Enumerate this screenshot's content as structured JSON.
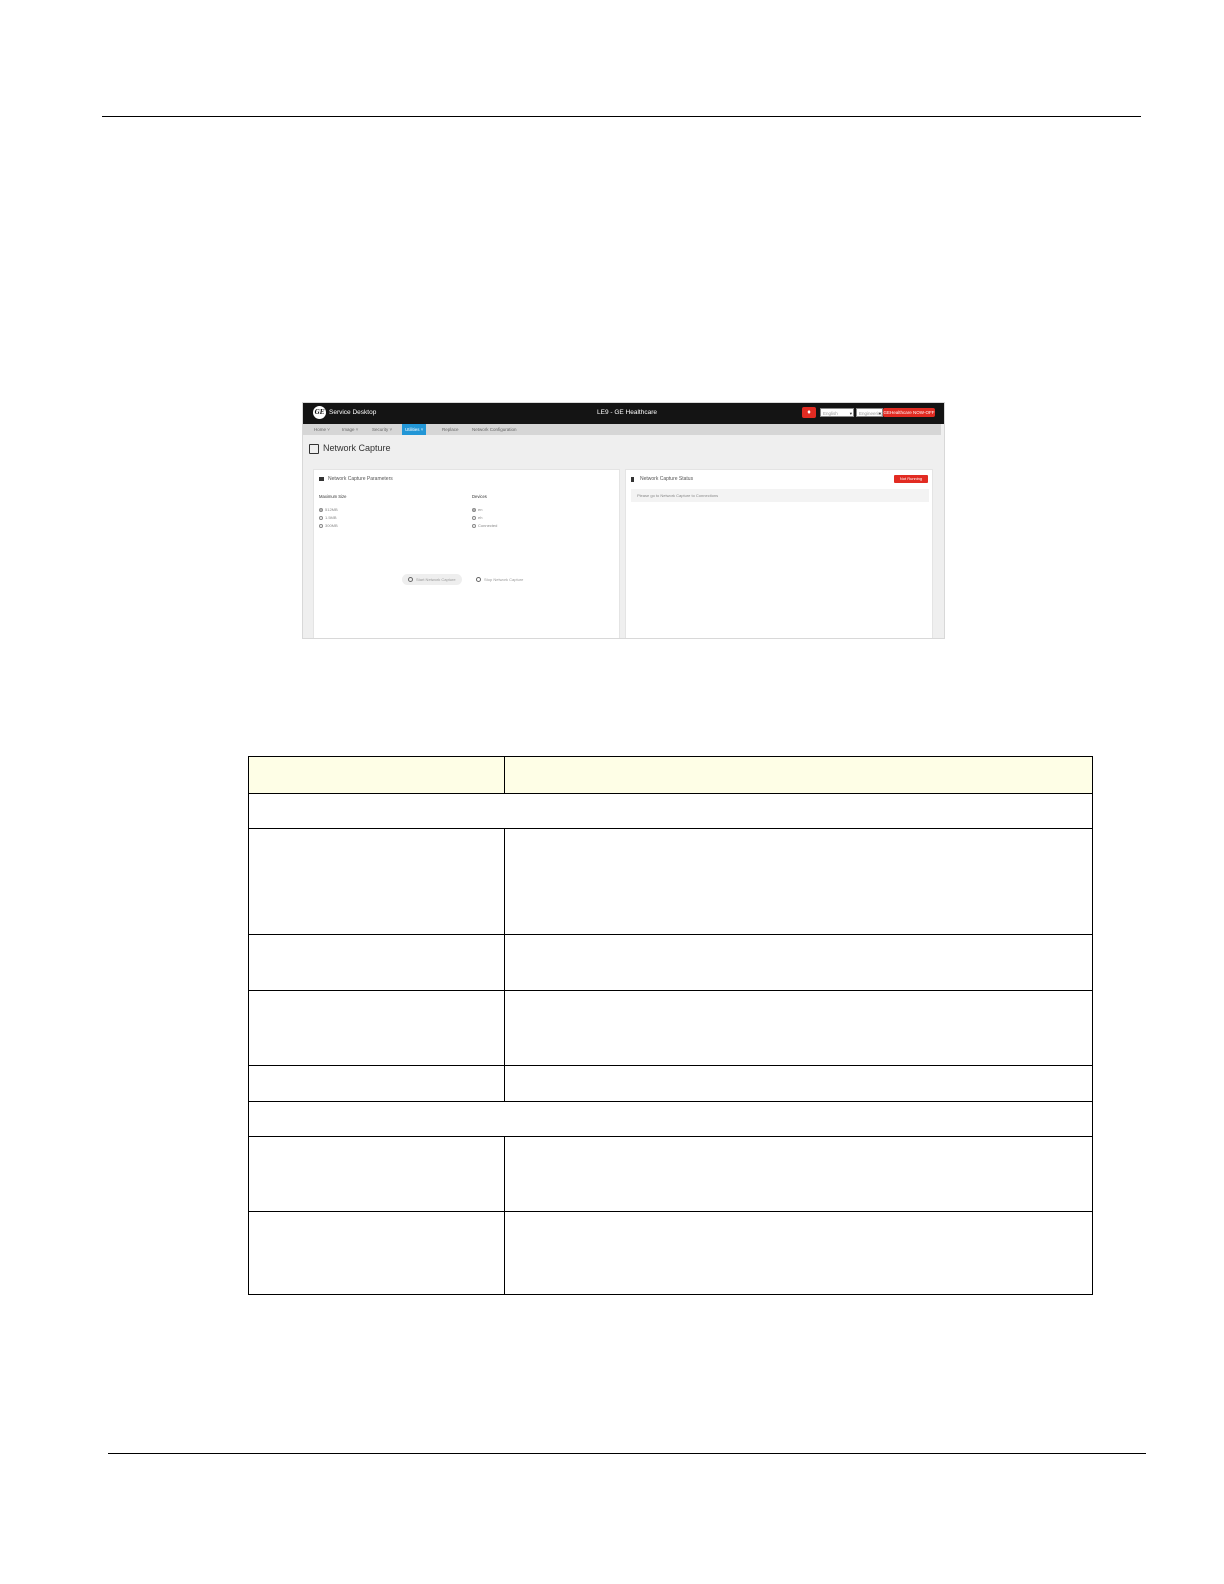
{
  "screenshot": {
    "app_name": "Service Desktop",
    "window_title": "LE9 - GE Healthcare",
    "logo_text": "GE",
    "header": {
      "bell_icon": "bell-icon",
      "language_select": "English",
      "role_select": "Engineering",
      "user_badge": "GEHealthcare NOW-OFF"
    },
    "nav_items": [
      {
        "label": "Home",
        "icon": "home-icon",
        "active": false
      },
      {
        "label": "Image",
        "icon": "image-icon",
        "active": false
      },
      {
        "label": "Security",
        "icon": "grid-icon",
        "active": false
      },
      {
        "label": "Utilities",
        "icon": "tools-icon",
        "active": true
      },
      {
        "label": "Replace",
        "icon": "heart-icon",
        "active": false
      },
      {
        "label": "Network Configuration",
        "icon": "wrench-icon",
        "active": false
      }
    ],
    "page_title": "Network Capture",
    "left_panel": {
      "title": "Network Capture Parameters",
      "max_size_label": "Maximum Size",
      "max_size_options": [
        {
          "label": "512MB",
          "selected": true
        },
        {
          "label": "1.5MB",
          "selected": false
        },
        {
          "label": "300MB",
          "selected": false
        }
      ],
      "devices_label": "Devices",
      "device_options": [
        {
          "label": "en",
          "selected": true
        },
        {
          "label": "eh",
          "selected": false
        },
        {
          "label": "Connected",
          "selected": false
        }
      ],
      "start_button": "Start Network Capture",
      "stop_button": "Stop Network Capture"
    },
    "right_panel": {
      "title": "Network Capture Status",
      "stop_badge": "Not Running",
      "status_message": "Please go to Network Capture to Connections"
    }
  },
  "table": {
    "header": [
      "",
      ""
    ],
    "rows": [
      {
        "type": "span",
        "cells": [
          ""
        ]
      },
      {
        "type": "pair",
        "cells": [
          "",
          ""
        ]
      },
      {
        "type": "pair",
        "cells": [
          "",
          ""
        ]
      },
      {
        "type": "pair",
        "cells": [
          "",
          ""
        ]
      },
      {
        "type": "pair",
        "cells": [
          "",
          ""
        ]
      },
      {
        "type": "span",
        "cells": [
          ""
        ]
      },
      {
        "type": "pair",
        "cells": [
          "",
          ""
        ]
      },
      {
        "type": "pair",
        "cells": [
          "",
          ""
        ]
      }
    ]
  }
}
